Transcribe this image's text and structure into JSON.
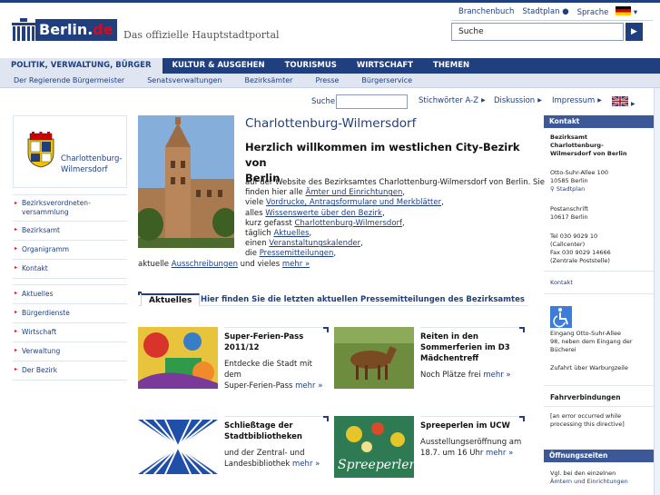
{
  "header": {
    "logo_text": "Berlin.",
    "logo_tld": "de",
    "tagline": "Das offizielle Hauptstadtportal",
    "toplinks": [
      "Branchenbuch",
      "Stadtplan",
      "Sprache"
    ],
    "search_placeholder": "Suche",
    "search_button": "▶"
  },
  "mainnav": [
    "POLITIK, VERWALTUNG, BÜRGER",
    "KULTUR & AUSGEHEN",
    "TOURISMUS",
    "WIRTSCHAFT",
    "THEMEN"
  ],
  "subnav": [
    "Der Regierende Bürgermeister",
    "Senatsverwaltungen",
    "Bezirksämter",
    "Presse",
    "Bürgerservice"
  ],
  "utilbar": {
    "search_label": "Suche",
    "links": [
      "Stichwörter A-Z",
      "Diskussion",
      "Impressum"
    ]
  },
  "leftcol": {
    "crest_name_1": "Charlottenburg-",
    "crest_name_2": "Wilmersdorf",
    "nav_group_1": [
      "Bezirksverordneten-",
      "versammlung",
      "Bezirksamt",
      "Organigramm",
      "Kontakt"
    ],
    "nav_group_2": [
      "Aktuelles",
      "Bürgerdienste",
      "Wirtschaft",
      "Verwaltung",
      "Der Bezirk"
    ]
  },
  "main": {
    "district_title": "Charlottenburg-Wilmersdorf",
    "welcome_1": "Herzlich willkommen im westlichen City-Bezirk von",
    "welcome_2": "Berlin",
    "intro": {
      "l1": "auf der Website des Bezirksamtes Charlottenburg-Wilmersdorf von Berlin. Sie",
      "l2a": "finden hier alle ",
      "l2b": "Ämter und Einrichtungen",
      "l2c": ",",
      "l3a": "viele ",
      "l3b": "Vordrucke, Antragsformulare und Merkblätter",
      "l3c": ",",
      "l4a": "alles ",
      "l4b": "Wissenswerte über den Bezirk",
      "l4c": ",",
      "l5a": "kurz gefasst ",
      "l5b": "Charlottenburg-Wilmersdorf",
      "l5c": ",",
      "l6a": "täglich ",
      "l6b": "Aktuelles",
      "l6c": ",",
      "l7a": "einen ",
      "l7b": "Veranstaltungskalender",
      "l7c": ",",
      "l8a": "die ",
      "l8b": "Pressemitteilungen",
      "l8c": ",",
      "l9a": "aktuelle ",
      "l9b": "Ausschreibungen",
      "l9c": " und vieles ",
      "l9d": "mehr »"
    },
    "news_tab": "Aktuelles",
    "news_caption": "Hier finden Sie die letzten aktuellen Pressemitteilungen des Bezirksamtes",
    "tiles": [
      {
        "title": "Super-Ferien-Pass 2011/12",
        "desc_1": "Entdecke die Stadt mit dem",
        "desc_2": "Super-Ferien-Pass",
        "more": "mehr »"
      },
      {
        "title": "Reiten in den Sommerferien im D3 Mädchentreff",
        "desc_1": "Noch Plätze frei",
        "desc_2": "",
        "more": "mehr »"
      },
      {
        "title": "Schließtage der Stadtbibliotheken",
        "desc_1": "und der Zentral- und",
        "desc_2": "Landesbibliothek",
        "more": "mehr »"
      },
      {
        "title": "Spreeperlen im UCW",
        "desc_1": "Ausstellungseröffnung am",
        "desc_2": "18.7. um 16 Uhr",
        "more": "mehr »"
      }
    ],
    "tile_img_text_4": "Spreeperlen"
  },
  "rightcol": {
    "kontakt_head": "Kontakt",
    "kontakt_org_1": "Bezirksamt",
    "kontakt_org_2": "Charlottenburg-",
    "kontakt_org_3": "Wilmersdorf von Berlin",
    "addr_1": "Otto-Suhr-Allee 100",
    "addr_2": "10585 Berlin",
    "stadtplan": "Stadtplan",
    "post_1": "Postanschrift",
    "post_2": "10617 Berlin",
    "tel_1": "Tel 030 9029 10",
    "tel_2": "(Callcenter)",
    "fax_1": "Fax 030 9029 14666",
    "fax_2": "(Zentrale Poststelle)",
    "kontakt_link": "Kontakt",
    "access_1": "Eingang Otto-Suhr-Allee",
    "access_2": "98, neben dem Eingang der",
    "access_3": "Bücherei",
    "access_4": "Zufahrt über Warburgzeile",
    "fahr_head": "Fahrverbindungen",
    "fahr_1": "[an error occurred while",
    "fahr_2": "processing this directive]",
    "oeff_head": "Öffnungszeiten",
    "oeff_1": "Vgl. bei den einzelnen",
    "oeff_2": "Ämtern und Einrichtungen"
  },
  "colors": {
    "brand_blue": "#1f3f7f",
    "accent_red": "#e30613",
    "light_blue": "#dfe6f1"
  }
}
